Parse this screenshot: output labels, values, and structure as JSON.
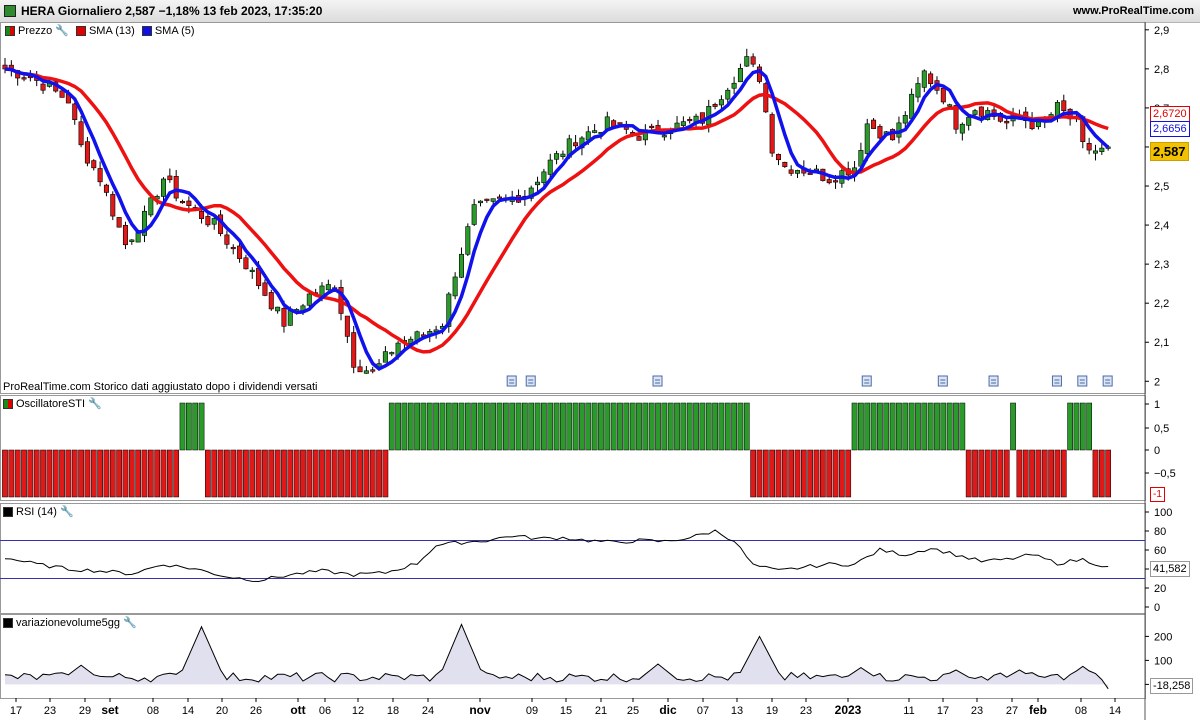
{
  "window": {
    "title": "HERA Giornaliero 2,587 −1,18% 13 feb 2023, 17:35:20",
    "site": "www.ProRealTime.com"
  },
  "legends": {
    "price": [
      {
        "label": "Prezzo",
        "color": "#1a8a1a"
      },
      {
        "label": "SMA (13)",
        "color": "#e00000"
      },
      {
        "label": "SMA (5)",
        "color": "#1010e0"
      }
    ],
    "sti": {
      "label": "OscillatoreSTI",
      "color": "#1a8a1a"
    },
    "rsi": {
      "label": "RSI (14)",
      "color": "#000000"
    },
    "vol": {
      "label": "variazionevolume5gg",
      "color": "#000000"
    }
  },
  "source_note": "ProRealTime.com Storico dati aggiustato dopo i dividendi versati",
  "price_labels": {
    "sma13": "2,6720",
    "sma5": "2,6656",
    "last": "2,587"
  },
  "sti_last": "-1",
  "rsi_last": "41,582",
  "vol_last": "-18,258",
  "axes": {
    "price_ticks": [
      "2,9",
      "2,8",
      "2,7",
      "2,6",
      "2,5",
      "2,4",
      "2,3",
      "2,2",
      "2,1",
      "2"
    ],
    "sti_ticks": [
      "1",
      "0,5",
      "0",
      "−0,5"
    ],
    "rsi_ticks": [
      "100",
      "80",
      "60",
      "40",
      "20",
      "0"
    ],
    "vol_ticks": [
      "200",
      "100",
      "0"
    ],
    "x_labels": [
      {
        "t": "17",
        "b": false
      },
      {
        "t": "23",
        "b": false
      },
      {
        "t": "29",
        "b": false
      },
      {
        "t": "set",
        "b": true
      },
      {
        "t": "08",
        "b": false
      },
      {
        "t": "14",
        "b": false
      },
      {
        "t": "20",
        "b": false
      },
      {
        "t": "26",
        "b": false
      },
      {
        "t": "ott",
        "b": true
      },
      {
        "t": "06",
        "b": false
      },
      {
        "t": "12",
        "b": false
      },
      {
        "t": "18",
        "b": false
      },
      {
        "t": "24",
        "b": false
      },
      {
        "t": "nov",
        "b": true
      },
      {
        "t": "09",
        "b": false
      },
      {
        "t": "15",
        "b": false
      },
      {
        "t": "21",
        "b": false
      },
      {
        "t": "25",
        "b": false
      },
      {
        "t": "dic",
        "b": true
      },
      {
        "t": "07",
        "b": false
      },
      {
        "t": "13",
        "b": false
      },
      {
        "t": "19",
        "b": false
      },
      {
        "t": "23",
        "b": false
      },
      {
        "t": "2023",
        "b": true
      },
      {
        "t": "11",
        "b": false
      },
      {
        "t": "17",
        "b": false
      },
      {
        "t": "23",
        "b": false
      },
      {
        "t": "27",
        "b": false
      },
      {
        "t": "feb",
        "b": true
      },
      {
        "t": "08",
        "b": false
      },
      {
        "t": "14",
        "b": false
      }
    ]
  },
  "colors": {
    "up": "#2a9a2a",
    "down": "#e01818",
    "sma13": "#ee1111",
    "sma5": "#1111ee",
    "grid": "#000",
    "band": "#3333aa",
    "area": "#e0e0ef"
  },
  "icons": {
    "wrench": "wrench-icon",
    "event": "document-icon"
  },
  "chart_data": [
    {
      "type": "candlestick",
      "title": "HERA Giornaliero",
      "ylim": [
        1.97,
        2.92
      ],
      "anchors": [
        [
          0,
          2.8
        ],
        [
          4,
          2.78
        ],
        [
          10,
          2.72
        ],
        [
          12,
          2.6
        ],
        [
          15,
          2.52
        ],
        [
          19,
          2.35
        ],
        [
          22,
          2.42
        ],
        [
          25,
          2.52
        ],
        [
          28,
          2.46
        ],
        [
          33,
          2.4
        ],
        [
          38,
          2.3
        ],
        [
          44,
          2.15
        ],
        [
          48,
          2.22
        ],
        [
          52,
          2.25
        ],
        [
          55,
          2.05
        ],
        [
          58,
          2.02
        ],
        [
          62,
          2.1
        ],
        [
          66,
          2.12
        ],
        [
          69,
          2.15
        ],
        [
          71,
          2.28
        ],
        [
          74,
          2.44
        ],
        [
          78,
          2.46
        ],
        [
          82,
          2.48
        ],
        [
          86,
          2.56
        ],
        [
          90,
          2.62
        ],
        [
          95,
          2.66
        ],
        [
          100,
          2.63
        ],
        [
          105,
          2.65
        ],
        [
          110,
          2.67
        ],
        [
          114,
          2.76
        ],
        [
          117,
          2.82
        ],
        [
          119,
          2.78
        ],
        [
          121,
          2.6
        ],
        [
          123,
          2.55
        ],
        [
          127,
          2.54
        ],
        [
          130,
          2.52
        ],
        [
          134,
          2.55
        ],
        [
          136,
          2.66
        ],
        [
          140,
          2.62
        ],
        [
          143,
          2.72
        ],
        [
          145,
          2.79
        ],
        [
          148,
          2.73
        ],
        [
          150,
          2.66
        ],
        [
          153,
          2.7
        ],
        [
          155,
          2.69
        ],
        [
          158,
          2.66
        ],
        [
          160,
          2.68
        ],
        [
          163,
          2.65
        ],
        [
          166,
          2.7
        ],
        [
          169,
          2.66
        ],
        [
          170,
          2.6
        ],
        [
          172,
          2.59
        ]
      ],
      "sma5": "SMA (5)",
      "sma13": "SMA (13)"
    },
    {
      "type": "bar",
      "series_name": "OscillatoreSTI",
      "ylim": [
        -1,
        1
      ],
      "runs": [
        [
          0,
          27,
          -1
        ],
        [
          28,
          31,
          1
        ],
        [
          32,
          60,
          -1
        ],
        [
          61,
          117,
          1
        ],
        [
          118,
          133,
          -1
        ],
        [
          134,
          151,
          1
        ],
        [
          152,
          158,
          -1
        ],
        [
          159,
          159,
          1
        ],
        [
          160,
          167,
          -1
        ],
        [
          168,
          171,
          1
        ],
        [
          172,
          174,
          -1
        ]
      ]
    },
    {
      "type": "line",
      "series_name": "RSI (14)",
      "ylim": [
        0,
        100
      ],
      "bands": [
        70,
        30
      ],
      "anchors": [
        [
          0,
          52
        ],
        [
          5,
          45
        ],
        [
          10,
          40
        ],
        [
          15,
          38
        ],
        [
          20,
          35
        ],
        [
          25,
          45
        ],
        [
          30,
          40
        ],
        [
          35,
          32
        ],
        [
          40,
          28
        ],
        [
          45,
          34
        ],
        [
          50,
          38
        ],
        [
          55,
          34
        ],
        [
          60,
          36
        ],
        [
          65,
          46
        ],
        [
          68,
          65
        ],
        [
          72,
          68
        ],
        [
          76,
          70
        ],
        [
          80,
          75
        ],
        [
          84,
          72
        ],
        [
          88,
          73
        ],
        [
          92,
          70
        ],
        [
          96,
          68
        ],
        [
          100,
          70
        ],
        [
          104,
          69
        ],
        [
          108,
          73
        ],
        [
          112,
          80
        ],
        [
          115,
          70
        ],
        [
          118,
          44
        ],
        [
          122,
          38
        ],
        [
          126,
          42
        ],
        [
          130,
          45
        ],
        [
          134,
          45
        ],
        [
          138,
          60
        ],
        [
          142,
          55
        ],
        [
          146,
          62
        ],
        [
          150,
          55
        ],
        [
          154,
          48
        ],
        [
          158,
          50
        ],
        [
          162,
          55
        ],
        [
          166,
          46
        ],
        [
          170,
          50
        ],
        [
          174,
          41.582
        ]
      ]
    },
    {
      "type": "area",
      "series_name": "variazionevolume5gg",
      "ylim": [
        -40,
        260
      ],
      "spikes": [
        [
          12,
          80
        ],
        [
          31,
          240
        ],
        [
          72,
          250
        ],
        [
          103,
          85
        ],
        [
          119,
          200
        ],
        [
          135,
          70
        ],
        [
          150,
          60
        ],
        [
          160,
          60
        ],
        [
          170,
          75
        ],
        [
          174,
          -18
        ]
      ]
    }
  ]
}
